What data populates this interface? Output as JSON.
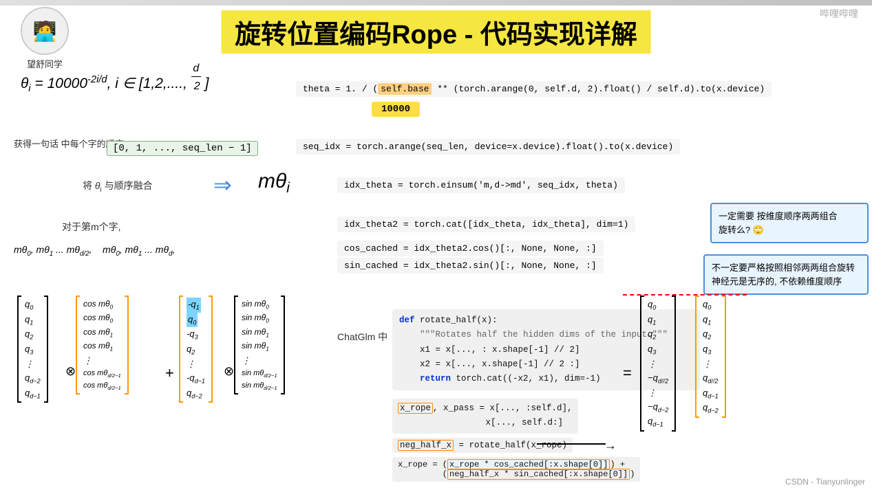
{
  "title": "旋转位置编码Rope - 代码实现详解",
  "avatar": {
    "emoji": "🧑‍💻",
    "label": "望舒同学"
  },
  "watermark_top_right": "哔哩哔哩",
  "watermark_bottom": "CSDN - Tianyunlinger",
  "sections": {
    "formula_theta": "θᵢ = 10000⁻²ⁱ/ᵈ, i ∈ [1,2,...., d/2]",
    "code_theta": "theta = 1. / (self.base ** (torch.arange(0, self.d, 2).float() / self.d).to(x.device)",
    "highlight_10000": "10000",
    "seq_label_1": "获得一句话\n中每个字的顺序",
    "seq_box": "[0, 1, ..., seq_len − 1]",
    "code_seq": "seq_idx = torch.arange(seq_len, device=x.device).float().to(x.device)",
    "combine_label": "将 θᵢ 与顺序融合",
    "combine_symbol": "mθᵢ",
    "code_combine": "idx_theta = torch.einsum('m,d->md', seq_idx, theta)",
    "for_label": "对于第m个字,",
    "matrix_label_1": "mθ₀, mθ₁ ... mθ_{d/2},   mθ₀, mθ₁ ... mθ_d,",
    "code_cat": "idx_theta2 = torch.cat([idx_theta, idx_theta], dim=1)",
    "annotation_1_line1": "一定需要 按维度顺序两两组合",
    "annotation_1_line2": "旋转么? 🙄",
    "code_cos": "cos_cached = idx_theta2.cos()[:, None, None, :]",
    "code_sin": "sin_cached = idx_theta2.sin()[:, None, None, :]",
    "annotation_2_line1": "不一定要严格按照相邻两两组合旋转",
    "annotation_2_line2": "神经元是无序的, 不依赖维度顺序",
    "chatglm_label": "ChatGlm 中",
    "code_def": "def rotate_half(x):",
    "code_docstring": "    \"\"\"Rotates half the hidden dims of the input.\"\"\"",
    "code_x1": "    x1 = x[..., : x.shape[-1] // 2]",
    "code_x2": "    x2 = x[..., x.shape[-1] // 2 :]",
    "code_return": "    return torch.cat((-x2, x1), dim=-1)",
    "code_xrope_pass": "x_rope, x_pass = x[..., :self.d],\n                 x[..., self.d:]",
    "code_neghalf": "neg_half_x = rotate_half(x_rope)",
    "code_xrope_final_1": "x_rope = (x_rope * cos_cached[:x.shape[0]]) +",
    "code_xrope_final_2": "         (neg_half_x * sin_cached[:x.shape[0]])"
  },
  "matrix_q_left": [
    "q₀",
    "q₁",
    "q₂",
    "q₃",
    "⋮",
    "q_{d-2}",
    "q_{d-1}"
  ],
  "matrix_cos": [
    "cos mθ₀",
    "cos mθ₀",
    "cos mθ₁",
    "cos mθ₁",
    "⋮",
    "cos mθ_{d/2-1}",
    "cos mθ_{d/2-1}"
  ],
  "matrix_neg_q_blue": [
    "-q₁",
    "q₀",
    "-q₃",
    "q₂",
    "⋮",
    "-q_{d-1}",
    "q_{d-2}"
  ],
  "matrix_sin": [
    "sin mθ₀",
    "sin mθ₀",
    "sin mθ₁",
    "sin mθ₁",
    "⋮",
    "sin mθ_{d/2-1}",
    "sin mθ_{d/2-1}"
  ],
  "matrix_q_right": [
    "q₀",
    "q₁",
    "q₂",
    "q₃",
    "⋮",
    "-q_{d//2}",
    "⋮",
    "-q_{d-2}",
    "q_{d-1}"
  ],
  "matrix_q_right2": [
    "q₀",
    "q₁",
    "q₂",
    "q₃",
    "⋮",
    "q_{d//2}",
    "q_{d-1}",
    "q_{d-2}"
  ]
}
